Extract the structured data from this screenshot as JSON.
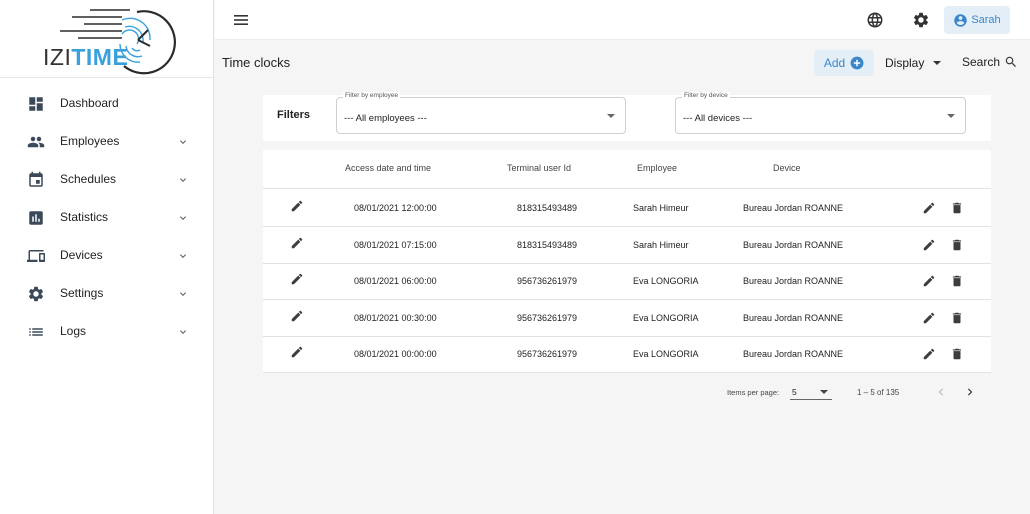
{
  "brand": {
    "name_part1": "IZI",
    "name_part2": "TIME",
    "accent": "#3aa0dc"
  },
  "sidebar": {
    "items": [
      {
        "label": "Dashboard",
        "icon": "dashboard-icon"
      },
      {
        "label": "Employees",
        "icon": "people-icon"
      },
      {
        "label": "Schedules",
        "icon": "calendar-icon"
      },
      {
        "label": "Statistics",
        "icon": "bar-chart-icon"
      },
      {
        "label": "Devices",
        "icon": "devices-icon"
      },
      {
        "label": "Settings",
        "icon": "gear-icon"
      },
      {
        "label": "Logs",
        "icon": "list-icon"
      }
    ]
  },
  "topbar": {
    "user_name": "Sarah"
  },
  "header": {
    "title": "Time clocks",
    "add_label": "Add",
    "display_label": "Display",
    "search_label": "Search"
  },
  "filters": {
    "label": "Filters",
    "employee": {
      "label": "Filter by employee",
      "value": "--- All employees ---"
    },
    "device": {
      "label": "Filter by device",
      "value": "--- All devices ---"
    }
  },
  "table": {
    "columns": [
      "Access date and time",
      "Terminal user Id",
      "Employee",
      "Device"
    ],
    "rows": [
      {
        "datetime": "08/01/2021 12:00:00",
        "terminal_id": "818315493489",
        "employee": "Sarah Himeur",
        "device": "Bureau Jordan ROANNE"
      },
      {
        "datetime": "08/01/2021 07:15:00",
        "terminal_id": "818315493489",
        "employee": "Sarah Himeur",
        "device": "Bureau Jordan ROANNE"
      },
      {
        "datetime": "08/01/2021 06:00:00",
        "terminal_id": "956736261979",
        "employee": "Eva LONGORIA",
        "device": "Bureau Jordan ROANNE"
      },
      {
        "datetime": "08/01/2021 00:30:00",
        "terminal_id": "956736261979",
        "employee": "Eva LONGORIA",
        "device": "Bureau Jordan ROANNE"
      },
      {
        "datetime": "08/01/2021 00:00:00",
        "terminal_id": "956736261979",
        "employee": "Eva LONGORIA",
        "device": "Bureau Jordan ROANNE"
      }
    ]
  },
  "pagination": {
    "items_per_page_label": "Items per page:",
    "items_per_page": "5",
    "range": "1 – 5 of 135"
  }
}
